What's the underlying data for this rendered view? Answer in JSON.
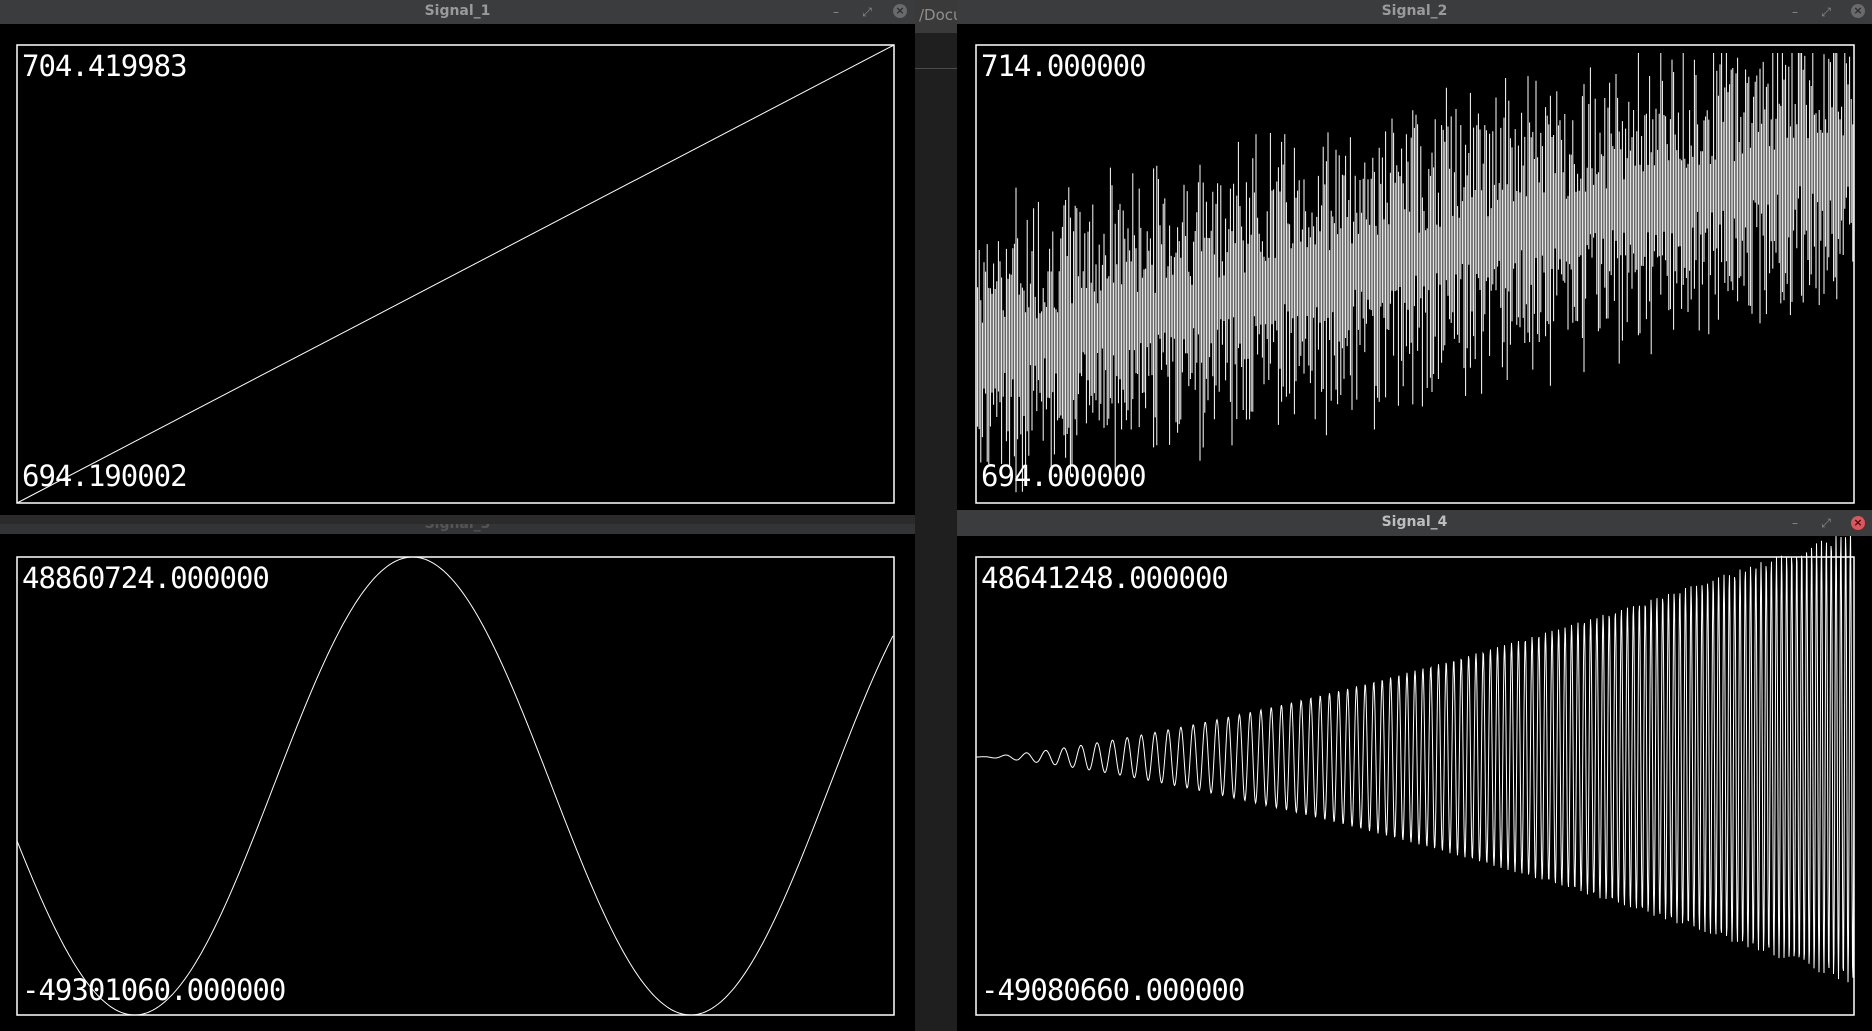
{
  "background_window": {
    "title_fragment": "/Docu"
  },
  "windows": [
    {
      "id": "signal1",
      "title": "Signal_1",
      "max_label": "704.419983",
      "min_label": "694.190002",
      "color": "#ffffff"
    },
    {
      "id": "signal2",
      "title": "Signal_2",
      "max_label": "714.000000",
      "min_label": "694.000000",
      "color": "#ffffff"
    },
    {
      "id": "signal3",
      "title": "Signal_3",
      "max_label": "48860724.000000",
      "min_label": "-49301060.000000",
      "color": "#ffffff"
    },
    {
      "id": "signal4",
      "title": "Signal_4",
      "max_label": "48641248.000000",
      "min_label": "-49080660.000000",
      "color": "#ffffff"
    }
  ],
  "controls": {
    "minimize": "–",
    "maximize": "⤢",
    "close": "×"
  },
  "colors": {
    "close_active": "#e0545a",
    "titlebar": "#3b3c3e",
    "plot_bg": "#000000",
    "trace": "#ffffff"
  }
}
